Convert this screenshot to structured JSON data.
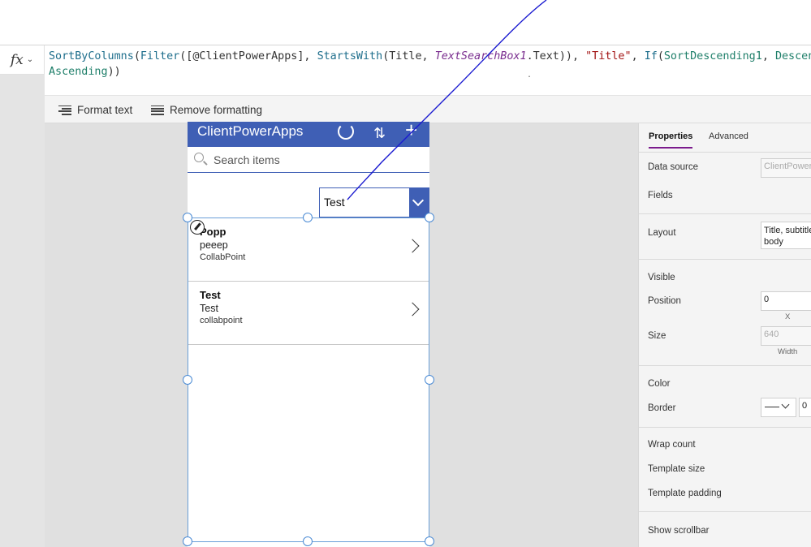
{
  "formula": {
    "fx_label": "fx",
    "p1": "SortByColumns",
    "p2": "(",
    "p3": "Filter",
    "p4": "([@ClientPowerApps], ",
    "p5": "StartsWith",
    "p6": "(Title, ",
    "p7": "TextSearchBox1",
    "p8": ".Text)), ",
    "p9": "\"Title\"",
    "p10": ", ",
    "p11": "If",
    "p12": "(",
    "p13": "SortDescending1",
    "p14": ", ",
    "p15": "Descending",
    "p16": ",",
    "p17": "Ascending",
    "p18": "))"
  },
  "toolbar": {
    "format_text": "Format text",
    "remove_formatting": "Remove formatting"
  },
  "app": {
    "title": "ClientPowerApps",
    "search_placeholder": "Search items",
    "dropdown_value": "Test",
    "items": [
      {
        "title": "Popp",
        "subtitle": "peeep",
        "body": "CollabPoint"
      },
      {
        "title": "Test",
        "subtitle": "Test",
        "body": "collabpoint"
      }
    ]
  },
  "panel": {
    "tab_properties": "Properties",
    "tab_advanced": "Advanced",
    "data_source_label": "Data source",
    "data_source_value": "ClientPowerApps",
    "fields_label": "Fields",
    "layout_label": "Layout",
    "layout_value_1": "Title, subtitle",
    "layout_value_2": "body",
    "visible_label": "Visible",
    "position_label": "Position",
    "position_x": "0",
    "x_caption": "X",
    "size_label": "Size",
    "size_width": "640",
    "width_caption": "Width",
    "color_label": "Color",
    "border_label": "Border",
    "border_value": "0",
    "wrap_count_label": "Wrap count",
    "template_size_label": "Template size",
    "template_padding_label": "Template padding",
    "show_scrollbar_label": "Show scrollbar"
  },
  "colors": {
    "header_blue": "#3f5fb5",
    "tab_accent": "#7b1a8c",
    "annotation": "#1a1ad0"
  }
}
